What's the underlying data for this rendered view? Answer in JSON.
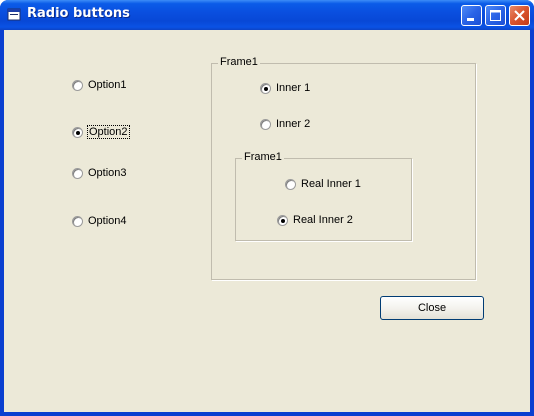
{
  "window": {
    "title": "Radio buttons"
  },
  "left_options": [
    {
      "label": "Option1",
      "checked": false
    },
    {
      "label": "Option2",
      "checked": true
    },
    {
      "label": "Option3",
      "checked": false
    },
    {
      "label": "Option4",
      "checked": false
    }
  ],
  "frame_outer": {
    "caption": "Frame1",
    "options": [
      {
        "label": "Inner 1",
        "checked": true
      },
      {
        "label": "Inner 2",
        "checked": false
      }
    ]
  },
  "frame_inner": {
    "caption": "Frame1",
    "options": [
      {
        "label": "Real Inner 1",
        "checked": false
      },
      {
        "label": "Real Inner 2",
        "checked": true
      }
    ]
  },
  "buttons": {
    "close_label": "Close"
  },
  "icons": {
    "app": "app-window-icon",
    "minimize": "minimize-icon",
    "maximize": "maximize-icon",
    "close": "close-icon"
  }
}
